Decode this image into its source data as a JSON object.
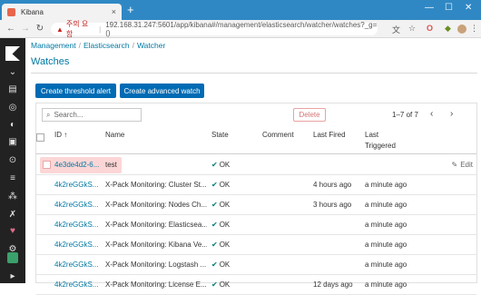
{
  "browser": {
    "tab_title": "Kibana",
    "tab_close": "×",
    "new_tab": "+",
    "url_warning_icon": "▲",
    "url_warning": "주의 요함",
    "url": "192.168.31.247:5601/app/kibana#/management/elasticsearch/watcher/watches?_g=()"
  },
  "breadcrumb": [
    "Management",
    "Elasticsearch",
    "Watcher"
  ],
  "page_title": "Watches",
  "buttons": {
    "create_threshold": "Create threshold alert",
    "create_advanced": "Create advanced watch"
  },
  "search": {
    "placeholder": "Search..."
  },
  "delete_label": "Delete",
  "pager": {
    "text": "1–7 of 7"
  },
  "columns": {
    "id": "ID ↑",
    "name": "Name",
    "state": "State",
    "comment": "Comment",
    "last_fired": "Last Fired",
    "last_triggered_1": "Last",
    "last_triggered_2": "Triggered"
  },
  "rows": [
    {
      "id": "4e3de4d2-6...",
      "name": "test",
      "state": "OK",
      "comment": "",
      "last_fired": "",
      "last_triggered": "",
      "edit": "Edit"
    },
    {
      "id": "4k2reGGkS...",
      "name": "X-Pack Monitoring: Cluster St...",
      "state": "OK",
      "comment": "",
      "last_fired": "4 hours ago",
      "last_triggered": "a minute ago"
    },
    {
      "id": "4k2reGGkS...",
      "name": "X-Pack Monitoring: Nodes Ch...",
      "state": "OK",
      "comment": "",
      "last_fired": "3 hours ago",
      "last_triggered": "a minute ago"
    },
    {
      "id": "4k2reGGkS...",
      "name": "X-Pack Monitoring: Elasticsea...",
      "state": "OK",
      "comment": "",
      "last_fired": "",
      "last_triggered": "a minute ago"
    },
    {
      "id": "4k2reGGkS...",
      "name": "X-Pack Monitoring: Kibana Ve...",
      "state": "OK",
      "comment": "",
      "last_fired": "",
      "last_triggered": "a minute ago"
    },
    {
      "id": "4k2reGGkS...",
      "name": "X-Pack Monitoring: Logstash ...",
      "state": "OK",
      "comment": "",
      "last_fired": "",
      "last_triggered": "a minute ago"
    },
    {
      "id": "4k2reGGkS...",
      "name": "X-Pack Monitoring: License E...",
      "state": "OK",
      "comment": "",
      "last_fired": "12 days ago",
      "last_triggered": "a minute ago"
    }
  ],
  "icons": {
    "ok": "✔",
    "edit": "✎"
  },
  "colors": {
    "accent": "#006bb4",
    "link": "#0079a5",
    "sidebar": "#222222",
    "highlight": "#fcd6d6"
  }
}
